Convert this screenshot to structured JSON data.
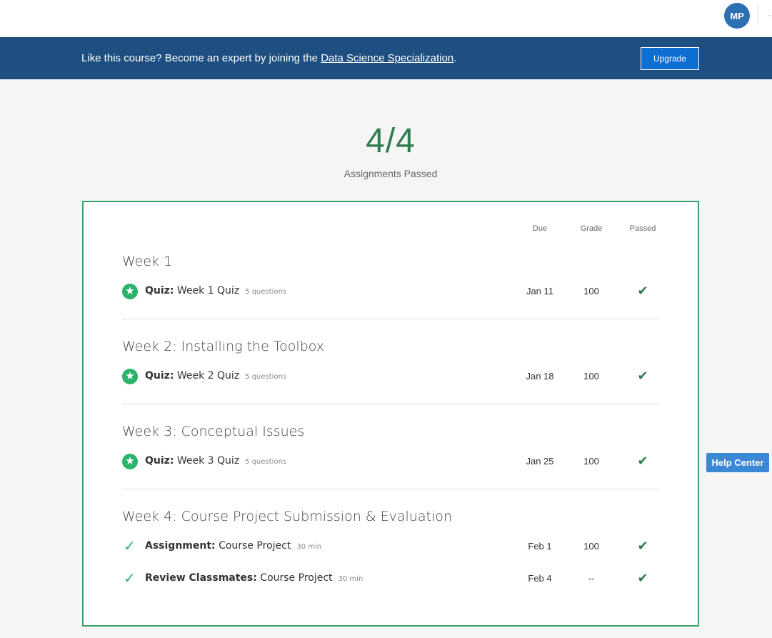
{
  "header": {
    "avatar_initials": "MP",
    "more_glyph": "·"
  },
  "banner": {
    "text_before": "Like this course? Become an expert by joining the ",
    "link_text": "Data Science Specialization",
    "text_after": ".",
    "upgrade_label": "Upgrade"
  },
  "summary": {
    "count": "4/4",
    "label": "Assignments Passed"
  },
  "columns": {
    "due": "Due",
    "grade": "Grade",
    "passed": "Passed"
  },
  "weeks": [
    {
      "title": "Week 1",
      "items": [
        {
          "type": "Quiz:",
          "name": "Week 1 Quiz",
          "meta": "5 questions",
          "due": "Jan 11",
          "grade": "100",
          "icon": "star-icon"
        }
      ]
    },
    {
      "title": "Week 2: Installing the Toolbox",
      "items": [
        {
          "type": "Quiz:",
          "name": "Week 2 Quiz",
          "meta": "5 questions",
          "due": "Jan 18",
          "grade": "100",
          "icon": "star-icon"
        }
      ]
    },
    {
      "title": "Week 3: Conceptual Issues",
      "items": [
        {
          "type": "Quiz:",
          "name": "Week 3 Quiz",
          "meta": "5 questions",
          "due": "Jan 25",
          "grade": "100",
          "icon": "star-icon"
        }
      ]
    },
    {
      "title": "Week 4: Course Project Submission & Evaluation",
      "items": [
        {
          "type": "Assignment:",
          "name": "Course Project",
          "meta": "30 min",
          "due": "Feb 1",
          "grade": "100",
          "icon": "check-icon"
        },
        {
          "type": "Review Classmates:",
          "name": "Course Project",
          "meta": "30 min",
          "due": "Feb 4",
          "grade": "--",
          "icon": "check-icon"
        }
      ]
    }
  ],
  "help": {
    "label": "Help Center"
  },
  "colors": {
    "banner": "#1f4f80",
    "accent_green": "#2bb36b",
    "upgrade": "#0f6ed1",
    "help": "#3b88d4"
  }
}
